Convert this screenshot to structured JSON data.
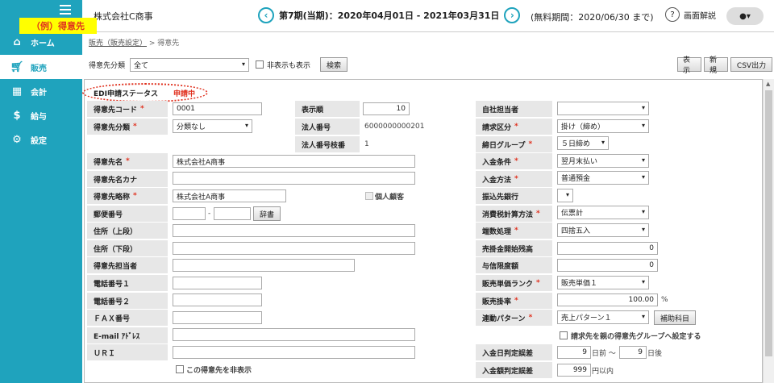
{
  "tag": "（例）得意先",
  "nav": {
    "items": [
      {
        "label": "ホーム"
      },
      {
        "label": "販売"
      },
      {
        "label": "会計"
      },
      {
        "label": "給与"
      },
      {
        "label": "設定"
      }
    ]
  },
  "header": {
    "company": "株式会社C商事",
    "period": "第7期(当期)：2020年04月01日 - 2021年03月31日",
    "prev": "‹",
    "next": "›",
    "trial": "(無料期間：2020/06/30 まで)",
    "help": "画面解説"
  },
  "breadcrumb": {
    "parent": "販売（販売設定）",
    "sep": " > ",
    "current": "得意先"
  },
  "toolbar": {
    "filter_label": "得意先分類",
    "filter_value": "全て",
    "show_hidden": "非表示も表示",
    "search": "検索",
    "btn_show": "表示",
    "btn_new": "新規",
    "btn_csv": "CSV出力"
  },
  "form": {
    "edi_label": "EDI申請ステータス",
    "edi_value": "申請中",
    "code_label": "得意先コード",
    "code_value": "0001",
    "order_label": "表示順",
    "order_value": "10",
    "staff_label": "自社担当者",
    "staff_value": "",
    "class_label": "得意先分類",
    "class_value": "分類なし",
    "corp_no_label": "法人番号",
    "corp_no_value": "6000000000201",
    "bill_label": "請求区分",
    "bill_value": "掛け（締め）",
    "corp_branch_label": "法人番号枝番",
    "corp_branch_value": "1",
    "close_label": "締日グループ",
    "close_value": "５日締め",
    "name_label": "得意先名",
    "name_value": "株式会社A商事",
    "pay_cond_label": "入金条件",
    "pay_cond_value": "翌月末払い",
    "kana_label": "得意先名カナ",
    "kana_value": "",
    "pay_method_label": "入金方法",
    "pay_method_value": "普通預金",
    "short_label": "得意先略称",
    "short_value": "株式会社A商事",
    "personal_label": "個人顧客",
    "bank_label": "振込先銀行",
    "bank_value": "",
    "zip_label": "郵便番号",
    "zip_dash": "-",
    "dict": "辞書",
    "tax_label": "消費税計算方法",
    "tax_value": "伝票計",
    "addr1_label": "住所（上段）",
    "round_label": "端数処理",
    "round_value": "四捨五入",
    "addr2_label": "住所（下段）",
    "ar_label": "売掛金開始残高",
    "ar_value": "0",
    "contact_label": "得意先担当者",
    "credit_label": "与信限度額",
    "credit_value": "0",
    "tel1_label": "電話番号１",
    "rank_label": "販売単価ランク",
    "rank_value": "販売単価１",
    "tel2_label": "電話番号２",
    "rate_label": "販売掛率",
    "rate_value": "100.00",
    "rate_unit": "%",
    "fax_label": "ＦＡＸ番号",
    "link_label": "連動パターン",
    "link_value": "売上パターン１",
    "aux": "補助科目",
    "email_label": "E-mail ｱﾄﾞﾚｽ",
    "parent_group": "請求先を親の得意先グループへ設定する",
    "url_label": "ＵＲＩ",
    "date_tol_label": "入金日判定誤差",
    "date_before": "9",
    "date_before_unit": "日前 ～",
    "date_after": "9",
    "date_after_unit": "日後",
    "hide_label": "この得意先を非表示",
    "amt_tol_label": "入金額判定誤差",
    "amt_tol_value": "999",
    "amt_tol_unit": "円以内"
  }
}
